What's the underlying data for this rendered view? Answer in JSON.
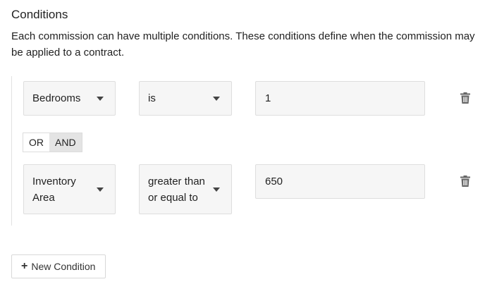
{
  "section": {
    "title": "Conditions",
    "description": "Each commission can have multiple conditions. These conditions define when the commission may be applied to a contract."
  },
  "conditions": [
    {
      "field": [
        "Bedrooms"
      ],
      "operator": [
        "is"
      ],
      "value": "1"
    },
    {
      "field": [
        "Inventory",
        "Area"
      ],
      "operator": [
        "greater than",
        "or equal to"
      ],
      "value": "650"
    }
  ],
  "logic_toggle": {
    "options": [
      "OR",
      "AND"
    ],
    "selected": "AND"
  },
  "new_condition_button": {
    "icon": "plus-icon",
    "label": "New Condition"
  },
  "icons": {
    "delete": "trash-icon",
    "dropdown": "caret-down-icon"
  }
}
